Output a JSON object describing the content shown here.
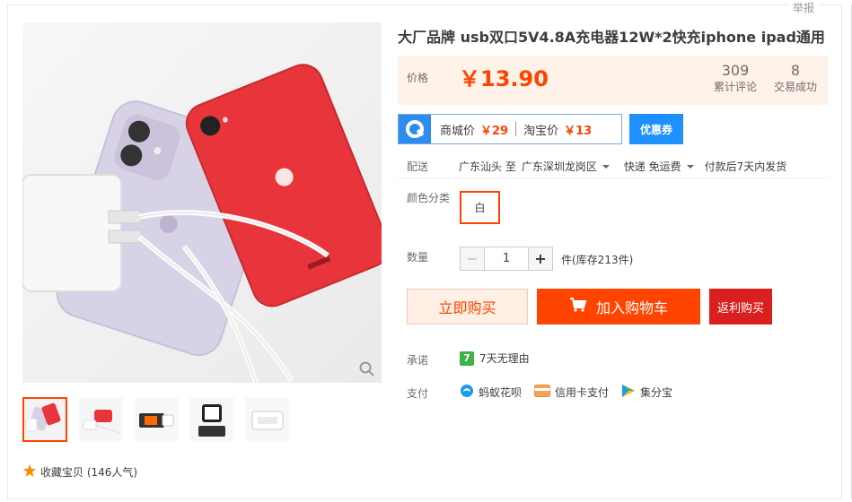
{
  "header": {
    "report_link": "举报"
  },
  "product": {
    "title": "大厂品牌 usb双口5V4.8A充电器12W*2快充iphone ipad通用"
  },
  "price": {
    "label": "价格",
    "value": "￥13.90",
    "stats": [
      {
        "count": "309",
        "label": "累计评论"
      },
      {
        "count": "8",
        "label": "交易成功"
      }
    ]
  },
  "compare": {
    "mall_label": "商城价",
    "mall_price": "￥29",
    "taobao_label": "淘宝价",
    "taobao_price": "￥13",
    "coupon_label": "优惠券"
  },
  "delivery": {
    "label": "配送",
    "from": "广东汕头 至",
    "to": "广东深圳龙岗区",
    "shipping": "快递 免运费",
    "dispatch": "付款后7天内发货"
  },
  "options": {
    "color_label": "颜色分类",
    "color_selected": "白"
  },
  "quantity": {
    "label": "数量",
    "minus": "−",
    "value": "1",
    "plus": "+",
    "stock": "件(库存213件)"
  },
  "actions": {
    "buy_now": "立即购买",
    "add_to_cart": "加入购物车",
    "rebate": "返利购买"
  },
  "promise": {
    "label": "承诺",
    "badge": "7",
    "text": "7天无理由"
  },
  "payment": {
    "label": "支付",
    "methods": [
      "蚂蚁花呗",
      "信用卡支付",
      "集分宝"
    ]
  },
  "favorites": {
    "text": "收藏宝贝 (146人气)"
  },
  "colors": {
    "accent": "#ff4400",
    "rebate": "#d9201f",
    "coupon": "#1e90ff",
    "price_bg": "#fff2e8"
  }
}
